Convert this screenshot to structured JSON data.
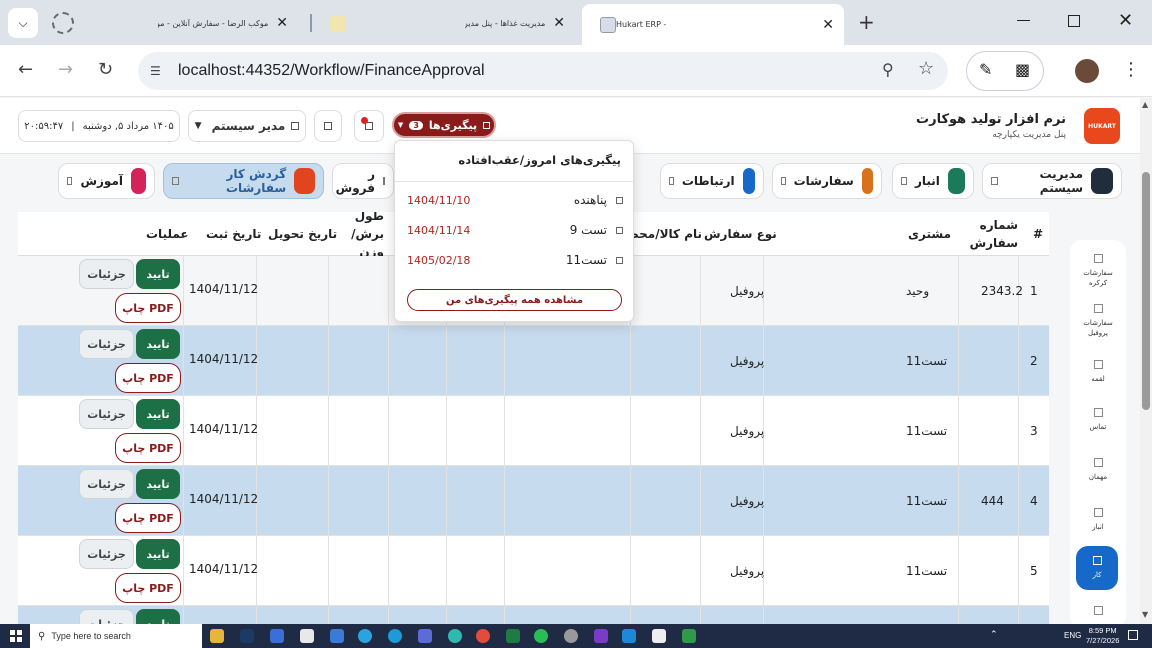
{
  "browser": {
    "tabs": [
      {
        "title": "موکب الرضا - سفارش آنلاین - موکب الرضا"
      },
      {
        "title": "مدیریت غذاها - پنل مدیریت"
      },
      {
        "title": "Hukart ERP -"
      }
    ],
    "url": "localhost:44352/Workflow/FinanceApproval"
  },
  "app": {
    "title": "نرم افزار تولید هوکارت",
    "subtitle": "پنل مدیریت یکپارچه",
    "logo_text": "HUKART",
    "followups_label": "پیگیری‌ها",
    "followups_count": "3",
    "user_label": "مدیر سیستم",
    "datetime": "۱۴۰۵ مرداد ۵, دوشنبه",
    "clock": "۲۰:۵۹:۴۷",
    "separator": "|"
  },
  "nav_cards": [
    {
      "label": "مدیریت سیستم",
      "color": "#1f2d3d"
    },
    {
      "label": "انبار",
      "color": "#1b7a5a"
    },
    {
      "label": "سفارشات",
      "color": "#d9711c"
    },
    {
      "label": "ارتباطات",
      "color": "#1668c9"
    },
    {
      "label": "ر فروش",
      "color": "#ffffff"
    },
    {
      "label": "گردش کار سفارشات",
      "color": "#e0451f"
    },
    {
      "label": "آموزش",
      "color": "#d4235a"
    }
  ],
  "dropdown": {
    "title": "پیگیری‌های امروز/عقب‌افتاده",
    "items": [
      {
        "name": "پناهنده",
        "date": "1404/11/10"
      },
      {
        "name": "تست 9",
        "date": "1404/11/14"
      },
      {
        "name": "تست11",
        "date": "1405/02/18"
      }
    ],
    "view_all": "مشاهده همه پیگیری‌های من"
  },
  "table": {
    "headers": {
      "num": "#",
      "order_no": "شماره سفارش",
      "customer": "مشتری",
      "order_type": "نوع سفارش",
      "product": "نام کالا/محصو",
      "cut_length": "طول برش/ وزن",
      "delivery_date": "تاریخ تحویل",
      "register_date": "تاریخ ثبت",
      "actions": "عملیات"
    },
    "rows": [
      {
        "num": "1",
        "order_no": "2343.2",
        "customer": "وحید",
        "order_type": "پروفیل",
        "register_date": "1404/11/12"
      },
      {
        "num": "2",
        "order_no": "",
        "customer": "تست11",
        "order_type": "پروفیل",
        "register_date": "1404/11/12"
      },
      {
        "num": "3",
        "order_no": "",
        "customer": "تست11",
        "order_type": "پروفیل",
        "register_date": "1404/11/12"
      },
      {
        "num": "4",
        "order_no": "444",
        "customer": "تست11",
        "order_type": "پروفیل",
        "register_date": "1404/11/12"
      },
      {
        "num": "5",
        "order_no": "",
        "customer": "تست11",
        "order_type": "پروفیل",
        "register_date": "1404/11/12"
      }
    ],
    "btn_approve": "تایید",
    "btn_details": "جزئیات",
    "btn_pdf": "چاپ PDF"
  },
  "sidebar": [
    {
      "label": "سفارشات کرکره"
    },
    {
      "label": "سفارشات پروفیل"
    },
    {
      "label": "لقمه"
    },
    {
      "label": "تماس"
    },
    {
      "label": "مهمان"
    },
    {
      "label": "انبار"
    },
    {
      "label": "کار"
    }
  ],
  "taskbar": {
    "search_placeholder": "Type here to search",
    "lang": "ENG",
    "time": "8:59 PM",
    "date": "7/27/2026"
  }
}
